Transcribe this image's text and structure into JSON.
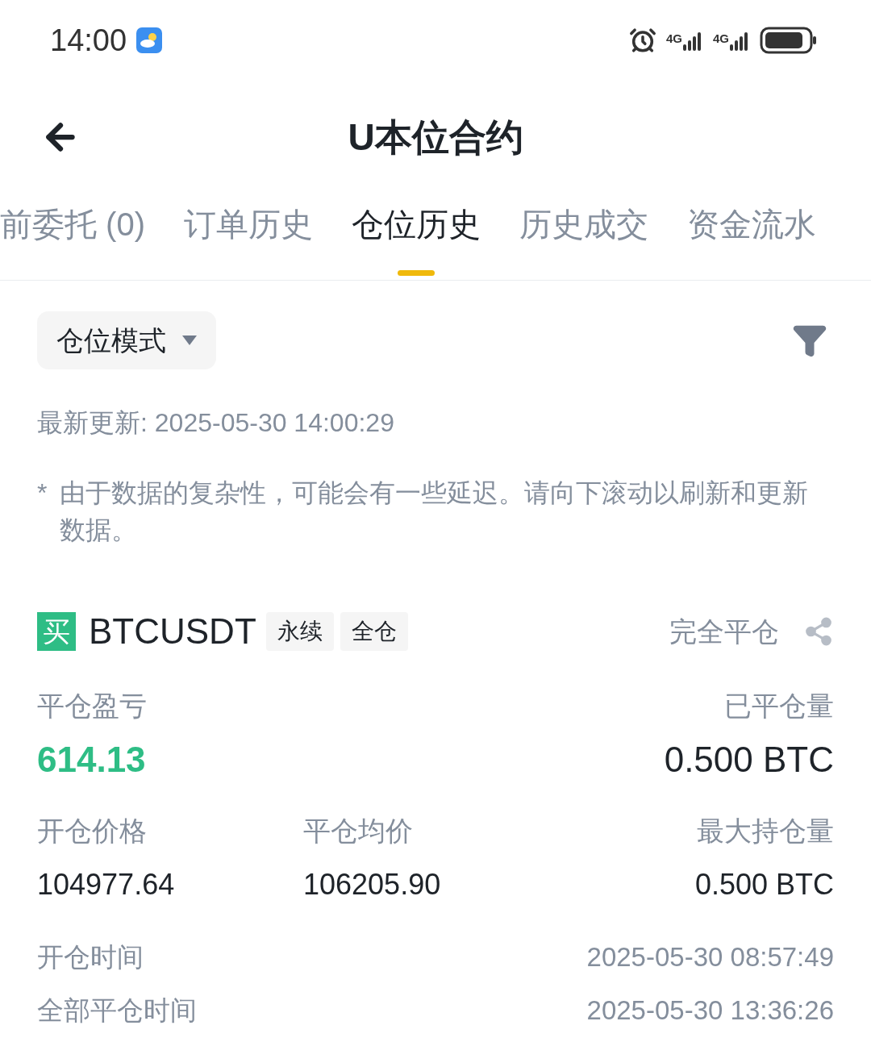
{
  "status_bar": {
    "time": "14:00",
    "network_1": "4G",
    "network_2": "4G"
  },
  "header": {
    "title": "U本位合约"
  },
  "tabs": [
    {
      "label": "前委托 (0)",
      "selected": false
    },
    {
      "label": "订单历史",
      "selected": false
    },
    {
      "label": "仓位历史",
      "selected": true
    },
    {
      "label": "历史成交",
      "selected": false
    },
    {
      "label": "资金流水",
      "selected": false
    }
  ],
  "mode_dropdown": {
    "label": "仓位模式"
  },
  "last_updated": "最新更新: 2025-05-30 14:00:29",
  "notice": {
    "mark": "*",
    "text": "由于数据的复杂性，可能会有一些延迟。请向下滚动以刷新和更新数据。"
  },
  "positions": [
    {
      "side": "买",
      "kind": "buy",
      "symbol": "BTCUSDT",
      "tags": [
        "永续",
        "全仓"
      ],
      "status": "完全平仓",
      "pnl_label": "平仓盈亏",
      "pnl": "614.13",
      "closed_label": "已平仓量",
      "closed": "0.500 BTC",
      "fields": [
        {
          "label": "开仓价格",
          "value": "104977.64"
        },
        {
          "label": "平仓均价",
          "value": "106205.90"
        },
        {
          "label": "最大持仓量",
          "value": "0.500 BTC"
        }
      ],
      "times": [
        {
          "label": "开仓时间",
          "value": "2025-05-30 08:57:49"
        },
        {
          "label": "全部平仓时间",
          "value": "2025-05-30 13:36:26"
        }
      ]
    }
  ]
}
